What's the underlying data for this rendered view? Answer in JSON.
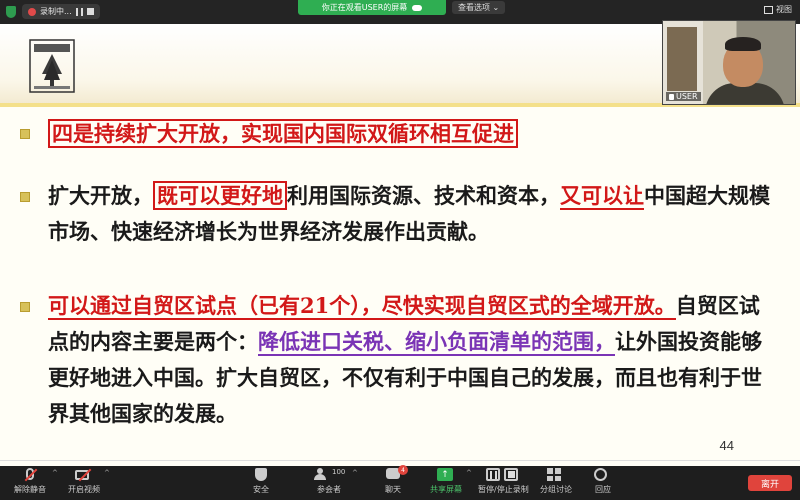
{
  "topbar": {
    "recording_label": "录制中...",
    "banner_text": "你正在观看USER的屏幕",
    "view_options": "查看选项",
    "view_button": "视图"
  },
  "slide": {
    "heading": "四是持续扩大开放，实现国内国际双循环相互促进",
    "para1": {
      "a": "扩大开放，",
      "b": "既可以更好地",
      "c": "利用国际资源、技术和资本，",
      "d": "又可以让",
      "e": "中国超大规模市场、快速经济增长为世界经济发展作出贡献。"
    },
    "para2": {
      "a": "可以通过自贸区试点（已有21个），尽快实现自贸区式的全域开放。",
      "b": "自贸区试点的内容主要是两个：",
      "c": "降低进口关税、缩小负面清单的范围，",
      "d": "让外国投资能够更好地进入中国。扩大自贸区，不仅有利于中国自己的发展，而且也有利于世界其他国家的发展。"
    },
    "page_number": "44"
  },
  "video": {
    "participant_name": "USER"
  },
  "toolbar": {
    "mute": "解除静音",
    "video": "开启视频",
    "security": "安全",
    "participants": "参会者",
    "participants_count": "100",
    "chat": "聊天",
    "chat_badge": "4",
    "share": "共享屏幕",
    "record": "暂停/停止录制",
    "breakout": "分组讨论",
    "reactions": "回应",
    "leave": "离开"
  },
  "colors": {
    "accent_red": "#d21818",
    "accent_purple": "#7a34b5",
    "share_green": "#2fae52"
  }
}
